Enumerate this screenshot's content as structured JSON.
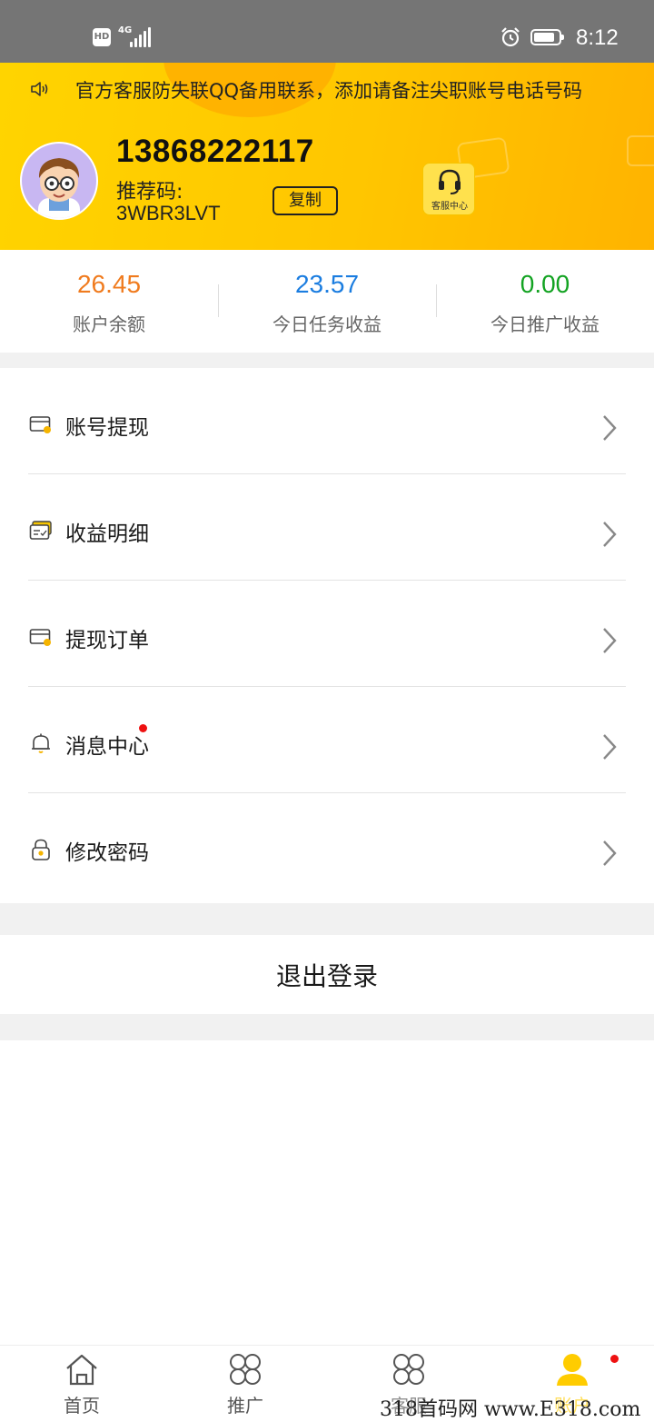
{
  "status_bar": {
    "hd": "HD",
    "network": "4G",
    "time": "8:12"
  },
  "header": {
    "notice": "官方客服防失联QQ备用联系，添加请备注尖职账号电话号码",
    "phone": "13868222117",
    "referral_label": "推荐码:",
    "referral_code": "3WBR3LVT",
    "copy_label": "复制",
    "customer_service_label": "客服中心"
  },
  "stats": [
    {
      "value": "26.45",
      "label": "账户余额",
      "color": "#f07b1e"
    },
    {
      "value": "23.57",
      "label": "今日任务收益",
      "color": "#1b7de0"
    },
    {
      "value": "0.00",
      "label": "今日推广收益",
      "color": "#13a322"
    }
  ],
  "menu": {
    "items": [
      {
        "label": "账号提现",
        "icon": "wallet-icon"
      },
      {
        "label": "收益明细",
        "icon": "cards-icon"
      },
      {
        "label": "提现订单",
        "icon": "wallet-icon"
      },
      {
        "label": "消息中心",
        "icon": "bell-icon",
        "badge": true
      },
      {
        "label": "修改密码",
        "icon": "lock-icon"
      }
    ]
  },
  "logout_label": "退出登录",
  "tabbar": {
    "tabs": [
      {
        "label": "首页",
        "icon": "home-icon"
      },
      {
        "label": "推广",
        "icon": "grid-icon"
      },
      {
        "label": "客服",
        "icon": "grid-icon"
      },
      {
        "label": "账户",
        "icon": "user-icon",
        "active": true,
        "badge": true
      }
    ]
  },
  "watermark": "318首码网 www.E318.com",
  "colors": {
    "brand_yellow": "#ffcc00",
    "badge_red": "#ee1111"
  }
}
